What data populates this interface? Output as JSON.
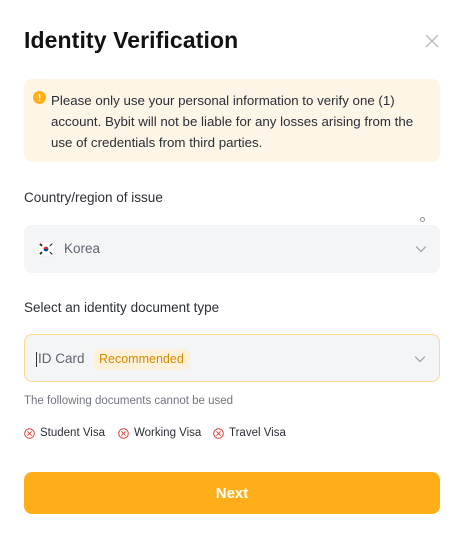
{
  "dialog": {
    "title": "Identity Verification",
    "close_icon": "close-icon"
  },
  "notice": {
    "icon": "warning-icon",
    "color": "#fdae18",
    "text": "Please only use your personal information to verify one (1) account. Bybit will not be liable for any losses arising from the use of credentials from third parties."
  },
  "country": {
    "label": "Country/region of issue",
    "flag_icon": "korea-flag-icon",
    "value": "Korea"
  },
  "document": {
    "label": "Select an identity document type",
    "value": "ID Card",
    "badge": "Recommended"
  },
  "restrictions": {
    "hint": "The following documents cannot be used",
    "items": [
      "Student Visa",
      "Working Visa",
      "Travel Visa"
    ],
    "icon": "x-circle-icon",
    "icon_color": "#e0463f"
  },
  "actions": {
    "next_label": "Next",
    "accent": "#fdae18"
  }
}
